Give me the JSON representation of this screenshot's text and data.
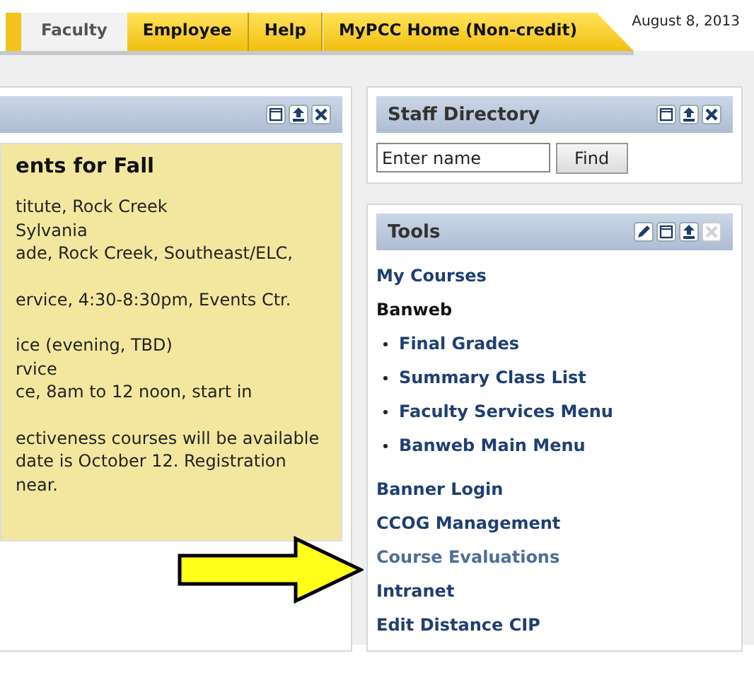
{
  "tabs": [
    {
      "label": "Faculty",
      "selected": true
    },
    {
      "label": "Employee",
      "selected": false
    },
    {
      "label": "Help",
      "selected": false
    },
    {
      "label": "MyPCC Home (Non-credit)",
      "selected": false
    }
  ],
  "date": "August 8, 2013",
  "announcement_panel": {
    "heading": "ents for Fall",
    "paragraphs": [
      [
        "titute, Rock Creek",
        "Sylvania",
        "ade, Rock Creek, Southeast/ELC,"
      ],
      [
        "ervice, 4:30-8:30pm, Events Ctr."
      ],
      [
        "ice (evening, TBD)",
        "rvice",
        "ce, 8am to 12 noon, start in"
      ],
      [
        "ectiveness courses will be available",
        "date is October 12. Registration",
        "near."
      ]
    ]
  },
  "staff_directory": {
    "title": "Staff Directory",
    "search": {
      "placeholder": "Enter name"
    },
    "button": "Find"
  },
  "tools": {
    "title": "Tools",
    "close_disabled": true,
    "items": [
      {
        "kind": "link",
        "label": "My Courses"
      },
      {
        "kind": "heading",
        "label": "Banweb"
      },
      {
        "kind": "bullet",
        "label": "Final Grades"
      },
      {
        "kind": "bullet",
        "label": "Summary Class List"
      },
      {
        "kind": "bullet",
        "label": "Faculty Services Menu"
      },
      {
        "kind": "bullet",
        "label": "Banweb Main Menu"
      },
      {
        "kind": "link",
        "label": "Banner Login"
      },
      {
        "kind": "link",
        "label": "CCOG Management"
      },
      {
        "kind": "visited",
        "label": "Course Evaluations"
      },
      {
        "kind": "link",
        "label": "Intranet"
      },
      {
        "kind": "link",
        "label": "Edit Distance CIP"
      }
    ]
  }
}
